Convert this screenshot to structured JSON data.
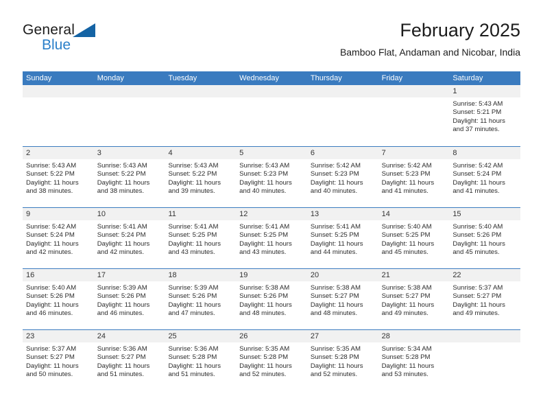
{
  "brand": {
    "line1": "General",
    "line2": "Blue",
    "triangle_icon": "blue-triangle-icon",
    "accent_color": "#1463a4",
    "blue_text_color": "#2a7fc9"
  },
  "header": {
    "title": "February 2025",
    "subtitle": "Bamboo Flat, Andaman and Nicobar, India"
  },
  "theme": {
    "header_row_bg": "#3a7bbf",
    "header_row_text": "#ffffff",
    "day_band_bg": "#f1f1f1",
    "row_border": "#3a7bbf",
    "body_text": "#2b2b2b"
  },
  "weekdays": [
    "Sunday",
    "Monday",
    "Tuesday",
    "Wednesday",
    "Thursday",
    "Friday",
    "Saturday"
  ],
  "labels": {
    "sunrise_prefix": "Sunrise:",
    "sunset_prefix": "Sunset:",
    "daylight_prefix": "Daylight:"
  },
  "weeks": [
    [
      {
        "day": "",
        "empty": true
      },
      {
        "day": "",
        "empty": true
      },
      {
        "day": "",
        "empty": true
      },
      {
        "day": "",
        "empty": true
      },
      {
        "day": "",
        "empty": true
      },
      {
        "day": "",
        "empty": true
      },
      {
        "day": "1",
        "sunrise": "Sunrise: 5:43 AM",
        "sunset": "Sunset: 5:21 PM",
        "daylight": "Daylight: 11 hours and 37 minutes."
      }
    ],
    [
      {
        "day": "2",
        "sunrise": "Sunrise: 5:43 AM",
        "sunset": "Sunset: 5:22 PM",
        "daylight": "Daylight: 11 hours and 38 minutes."
      },
      {
        "day": "3",
        "sunrise": "Sunrise: 5:43 AM",
        "sunset": "Sunset: 5:22 PM",
        "daylight": "Daylight: 11 hours and 38 minutes."
      },
      {
        "day": "4",
        "sunrise": "Sunrise: 5:43 AM",
        "sunset": "Sunset: 5:22 PM",
        "daylight": "Daylight: 11 hours and 39 minutes."
      },
      {
        "day": "5",
        "sunrise": "Sunrise: 5:43 AM",
        "sunset": "Sunset: 5:23 PM",
        "daylight": "Daylight: 11 hours and 40 minutes."
      },
      {
        "day": "6",
        "sunrise": "Sunrise: 5:42 AM",
        "sunset": "Sunset: 5:23 PM",
        "daylight": "Daylight: 11 hours and 40 minutes."
      },
      {
        "day": "7",
        "sunrise": "Sunrise: 5:42 AM",
        "sunset": "Sunset: 5:23 PM",
        "daylight": "Daylight: 11 hours and 41 minutes."
      },
      {
        "day": "8",
        "sunrise": "Sunrise: 5:42 AM",
        "sunset": "Sunset: 5:24 PM",
        "daylight": "Daylight: 11 hours and 41 minutes."
      }
    ],
    [
      {
        "day": "9",
        "sunrise": "Sunrise: 5:42 AM",
        "sunset": "Sunset: 5:24 PM",
        "daylight": "Daylight: 11 hours and 42 minutes."
      },
      {
        "day": "10",
        "sunrise": "Sunrise: 5:41 AM",
        "sunset": "Sunset: 5:24 PM",
        "daylight": "Daylight: 11 hours and 42 minutes."
      },
      {
        "day": "11",
        "sunrise": "Sunrise: 5:41 AM",
        "sunset": "Sunset: 5:25 PM",
        "daylight": "Daylight: 11 hours and 43 minutes."
      },
      {
        "day": "12",
        "sunrise": "Sunrise: 5:41 AM",
        "sunset": "Sunset: 5:25 PM",
        "daylight": "Daylight: 11 hours and 43 minutes."
      },
      {
        "day": "13",
        "sunrise": "Sunrise: 5:41 AM",
        "sunset": "Sunset: 5:25 PM",
        "daylight": "Daylight: 11 hours and 44 minutes."
      },
      {
        "day": "14",
        "sunrise": "Sunrise: 5:40 AM",
        "sunset": "Sunset: 5:25 PM",
        "daylight": "Daylight: 11 hours and 45 minutes."
      },
      {
        "day": "15",
        "sunrise": "Sunrise: 5:40 AM",
        "sunset": "Sunset: 5:26 PM",
        "daylight": "Daylight: 11 hours and 45 minutes."
      }
    ],
    [
      {
        "day": "16",
        "sunrise": "Sunrise: 5:40 AM",
        "sunset": "Sunset: 5:26 PM",
        "daylight": "Daylight: 11 hours and 46 minutes."
      },
      {
        "day": "17",
        "sunrise": "Sunrise: 5:39 AM",
        "sunset": "Sunset: 5:26 PM",
        "daylight": "Daylight: 11 hours and 46 minutes."
      },
      {
        "day": "18",
        "sunrise": "Sunrise: 5:39 AM",
        "sunset": "Sunset: 5:26 PM",
        "daylight": "Daylight: 11 hours and 47 minutes."
      },
      {
        "day": "19",
        "sunrise": "Sunrise: 5:38 AM",
        "sunset": "Sunset: 5:26 PM",
        "daylight": "Daylight: 11 hours and 48 minutes."
      },
      {
        "day": "20",
        "sunrise": "Sunrise: 5:38 AM",
        "sunset": "Sunset: 5:27 PM",
        "daylight": "Daylight: 11 hours and 48 minutes."
      },
      {
        "day": "21",
        "sunrise": "Sunrise: 5:38 AM",
        "sunset": "Sunset: 5:27 PM",
        "daylight": "Daylight: 11 hours and 49 minutes."
      },
      {
        "day": "22",
        "sunrise": "Sunrise: 5:37 AM",
        "sunset": "Sunset: 5:27 PM",
        "daylight": "Daylight: 11 hours and 49 minutes."
      }
    ],
    [
      {
        "day": "23",
        "sunrise": "Sunrise: 5:37 AM",
        "sunset": "Sunset: 5:27 PM",
        "daylight": "Daylight: 11 hours and 50 minutes."
      },
      {
        "day": "24",
        "sunrise": "Sunrise: 5:36 AM",
        "sunset": "Sunset: 5:27 PM",
        "daylight": "Daylight: 11 hours and 51 minutes."
      },
      {
        "day": "25",
        "sunrise": "Sunrise: 5:36 AM",
        "sunset": "Sunset: 5:28 PM",
        "daylight": "Daylight: 11 hours and 51 minutes."
      },
      {
        "day": "26",
        "sunrise": "Sunrise: 5:35 AM",
        "sunset": "Sunset: 5:28 PM",
        "daylight": "Daylight: 11 hours and 52 minutes."
      },
      {
        "day": "27",
        "sunrise": "Sunrise: 5:35 AM",
        "sunset": "Sunset: 5:28 PM",
        "daylight": "Daylight: 11 hours and 52 minutes."
      },
      {
        "day": "28",
        "sunrise": "Sunrise: 5:34 AM",
        "sunset": "Sunset: 5:28 PM",
        "daylight": "Daylight: 11 hours and 53 minutes."
      },
      {
        "day": "",
        "empty": true
      }
    ]
  ]
}
